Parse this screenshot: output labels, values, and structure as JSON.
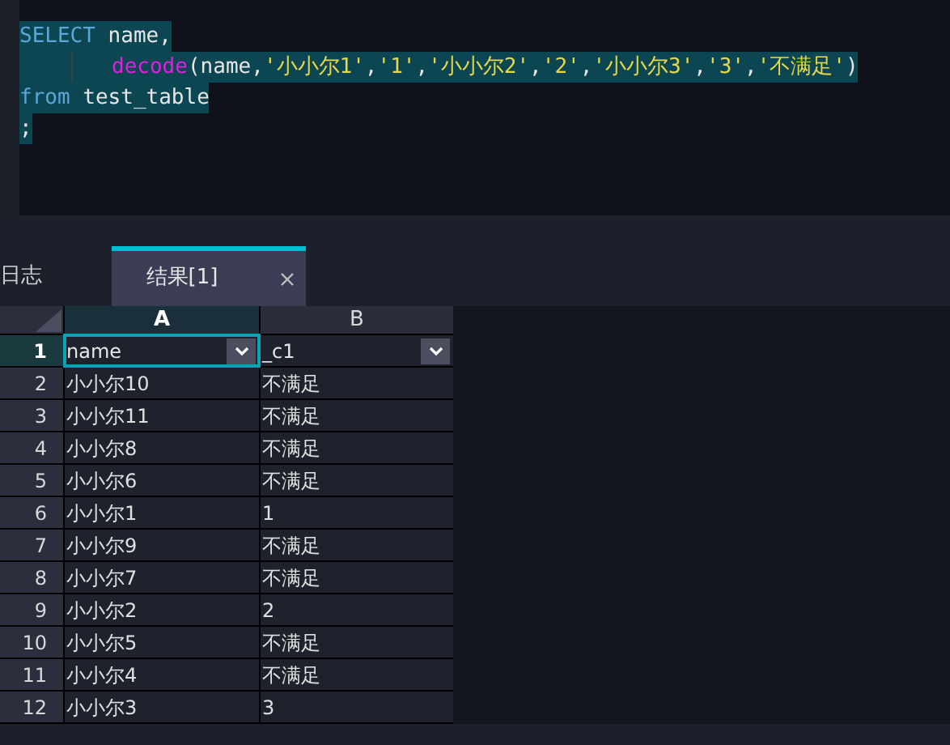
{
  "editor": {
    "lines": [
      {
        "selected": true,
        "indent": false,
        "tokens": [
          {
            "kind": "keyword",
            "text": "SELECT"
          },
          {
            "kind": "plain",
            "text": " name,"
          }
        ]
      },
      {
        "selected": true,
        "indent": true,
        "tokens": [
          {
            "kind": "function",
            "text": "decode"
          },
          {
            "kind": "plain",
            "text": "(name,"
          },
          {
            "kind": "string",
            "text": "'小小尔1'"
          },
          {
            "kind": "plain",
            "text": ","
          },
          {
            "kind": "string",
            "text": "'1'"
          },
          {
            "kind": "plain",
            "text": ","
          },
          {
            "kind": "string",
            "text": "'小小尔2'"
          },
          {
            "kind": "plain",
            "text": ","
          },
          {
            "kind": "string",
            "text": "'2'"
          },
          {
            "kind": "plain",
            "text": ","
          },
          {
            "kind": "string",
            "text": "'小小尔3'"
          },
          {
            "kind": "plain",
            "text": ","
          },
          {
            "kind": "string",
            "text": "'3'"
          },
          {
            "kind": "plain",
            "text": ","
          },
          {
            "kind": "string",
            "text": "'不满足'"
          },
          {
            "kind": "plain",
            "text": ")"
          }
        ]
      },
      {
        "selected": true,
        "indent": false,
        "tokens": [
          {
            "kind": "keyword",
            "text": "from"
          },
          {
            "kind": "plain",
            "text": " test_table"
          }
        ]
      },
      {
        "selected": true,
        "indent": false,
        "tokens": [
          {
            "kind": "plain",
            "text": ";"
          }
        ]
      }
    ]
  },
  "tabs": [
    {
      "label": "日志",
      "selected": false,
      "closable": false
    },
    {
      "label": "结果[1]",
      "selected": true,
      "closable": true
    }
  ],
  "grid": {
    "columns": [
      {
        "label": "A",
        "selected": true
      },
      {
        "label": "B",
        "selected": false
      }
    ],
    "rows": [
      {
        "number": "1",
        "header": true,
        "cells": [
          "name",
          "_c1"
        ]
      },
      {
        "number": "2",
        "header": false,
        "cells": [
          "小小尔10",
          "不满足"
        ]
      },
      {
        "number": "3",
        "header": false,
        "cells": [
          "小小尔11",
          "不满足"
        ]
      },
      {
        "number": "4",
        "header": false,
        "cells": [
          "小小尔8",
          "不满足"
        ]
      },
      {
        "number": "5",
        "header": false,
        "cells": [
          "小小尔6",
          "不满足"
        ]
      },
      {
        "number": "6",
        "header": false,
        "cells": [
          "小小尔1",
          "1"
        ]
      },
      {
        "number": "7",
        "header": false,
        "cells": [
          "小小尔9",
          "不满足"
        ]
      },
      {
        "number": "8",
        "header": false,
        "cells": [
          "小小尔7",
          "不满足"
        ]
      },
      {
        "number": "9",
        "header": false,
        "cells": [
          "小小尔2",
          "2"
        ]
      },
      {
        "number": "10",
        "header": false,
        "cells": [
          "小小尔5",
          "不满足"
        ]
      },
      {
        "number": "11",
        "header": false,
        "cells": [
          "小小尔4",
          "不满足"
        ]
      },
      {
        "number": "12",
        "header": false,
        "cells": [
          "小小尔3",
          "3"
        ]
      }
    ]
  }
}
